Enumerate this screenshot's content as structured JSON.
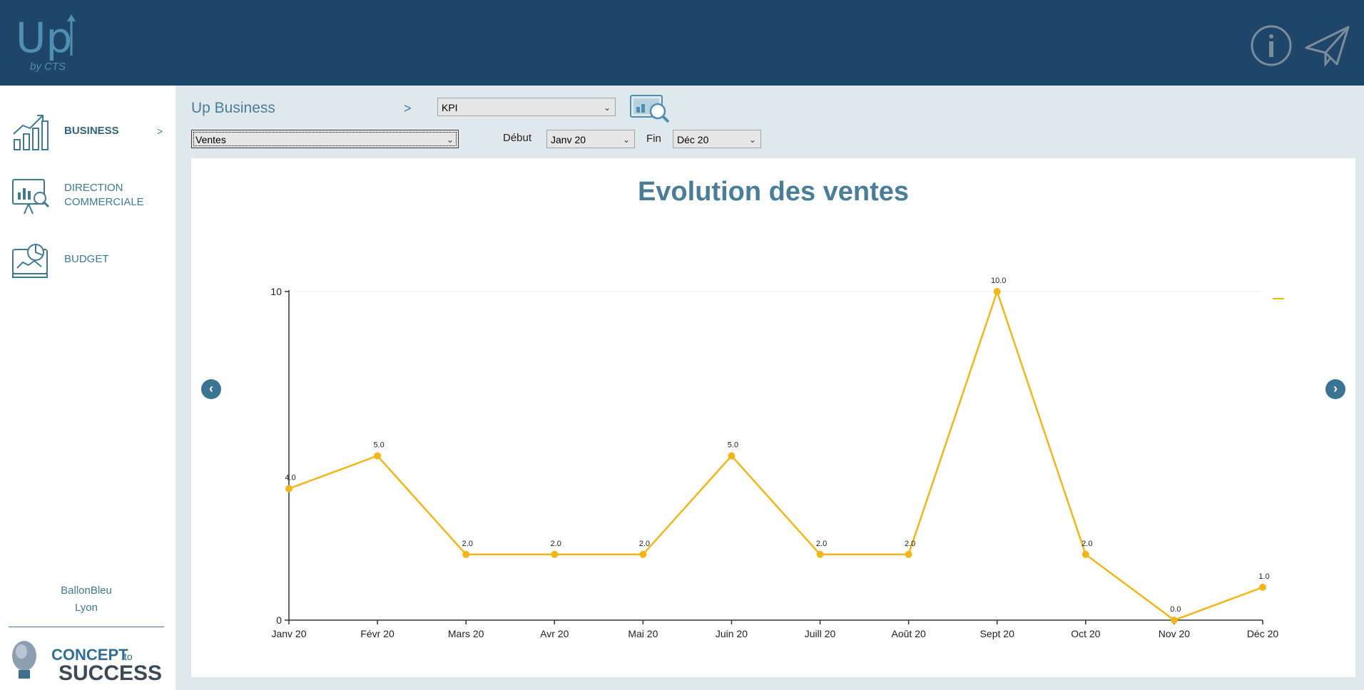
{
  "header": {
    "logo_text": "Up",
    "logo_sub": "by CTS",
    "info_icon": "info-circle-icon",
    "send_icon": "paper-plane-icon"
  },
  "sidebar": {
    "items": [
      {
        "label_lines": [
          "BUSINESS"
        ],
        "icon": "chart-trend-icon",
        "active": true,
        "arrow": ">"
      },
      {
        "label_lines": [
          "DIRECTION",
          "COMMERCIALE"
        ],
        "icon": "presentation-board-icon",
        "active": false
      },
      {
        "label_lines": [
          "BUDGET"
        ],
        "icon": "budget-report-icon",
        "active": false
      }
    ],
    "client": {
      "name": "BallonBleu",
      "city": "Lyon"
    },
    "brand": {
      "line1": "CONCEPT",
      "line1_small": "to",
      "line2": "SUCCESS"
    }
  },
  "toolbar": {
    "breadcrumb": "Up Business",
    "breadcrumb_sep": ">",
    "module_select": "KPI",
    "metric_select": "Ventes",
    "start_label": "Début",
    "start_value": "Janv 20",
    "end_label": "Fin",
    "end_value": "Déc 20",
    "analyze_icon": "dashboard-search-icon"
  },
  "chart_data": {
    "type": "line",
    "title": "Evolution des ventes",
    "categories": [
      "Janv 20",
      "Févr 20",
      "Mars 20",
      "Avr 20",
      "Mai 20",
      "Juin 20",
      "Juill 20",
      "Août 20",
      "Sept 20",
      "Oct 20",
      "Nov 20",
      "Déc 20"
    ],
    "series": [
      {
        "values": [
          4,
          5,
          2,
          2,
          2,
          5,
          2,
          2,
          10,
          2,
          0,
          1
        ],
        "labels": [
          "4.0",
          "5.0",
          "2.0",
          "2.0",
          "2.0",
          "5.0",
          "2.0",
          "2.0",
          "10.0",
          "2.0",
          "0.0",
          "1.0"
        ],
        "color": "#f2b619"
      }
    ],
    "yticks": [
      0,
      10
    ],
    "ylim": [
      0,
      10
    ],
    "grid": false,
    "legend": "top-right"
  },
  "colors": {
    "accent": "#4a7d97",
    "header": "#1f4568",
    "line": "#f2b619"
  }
}
